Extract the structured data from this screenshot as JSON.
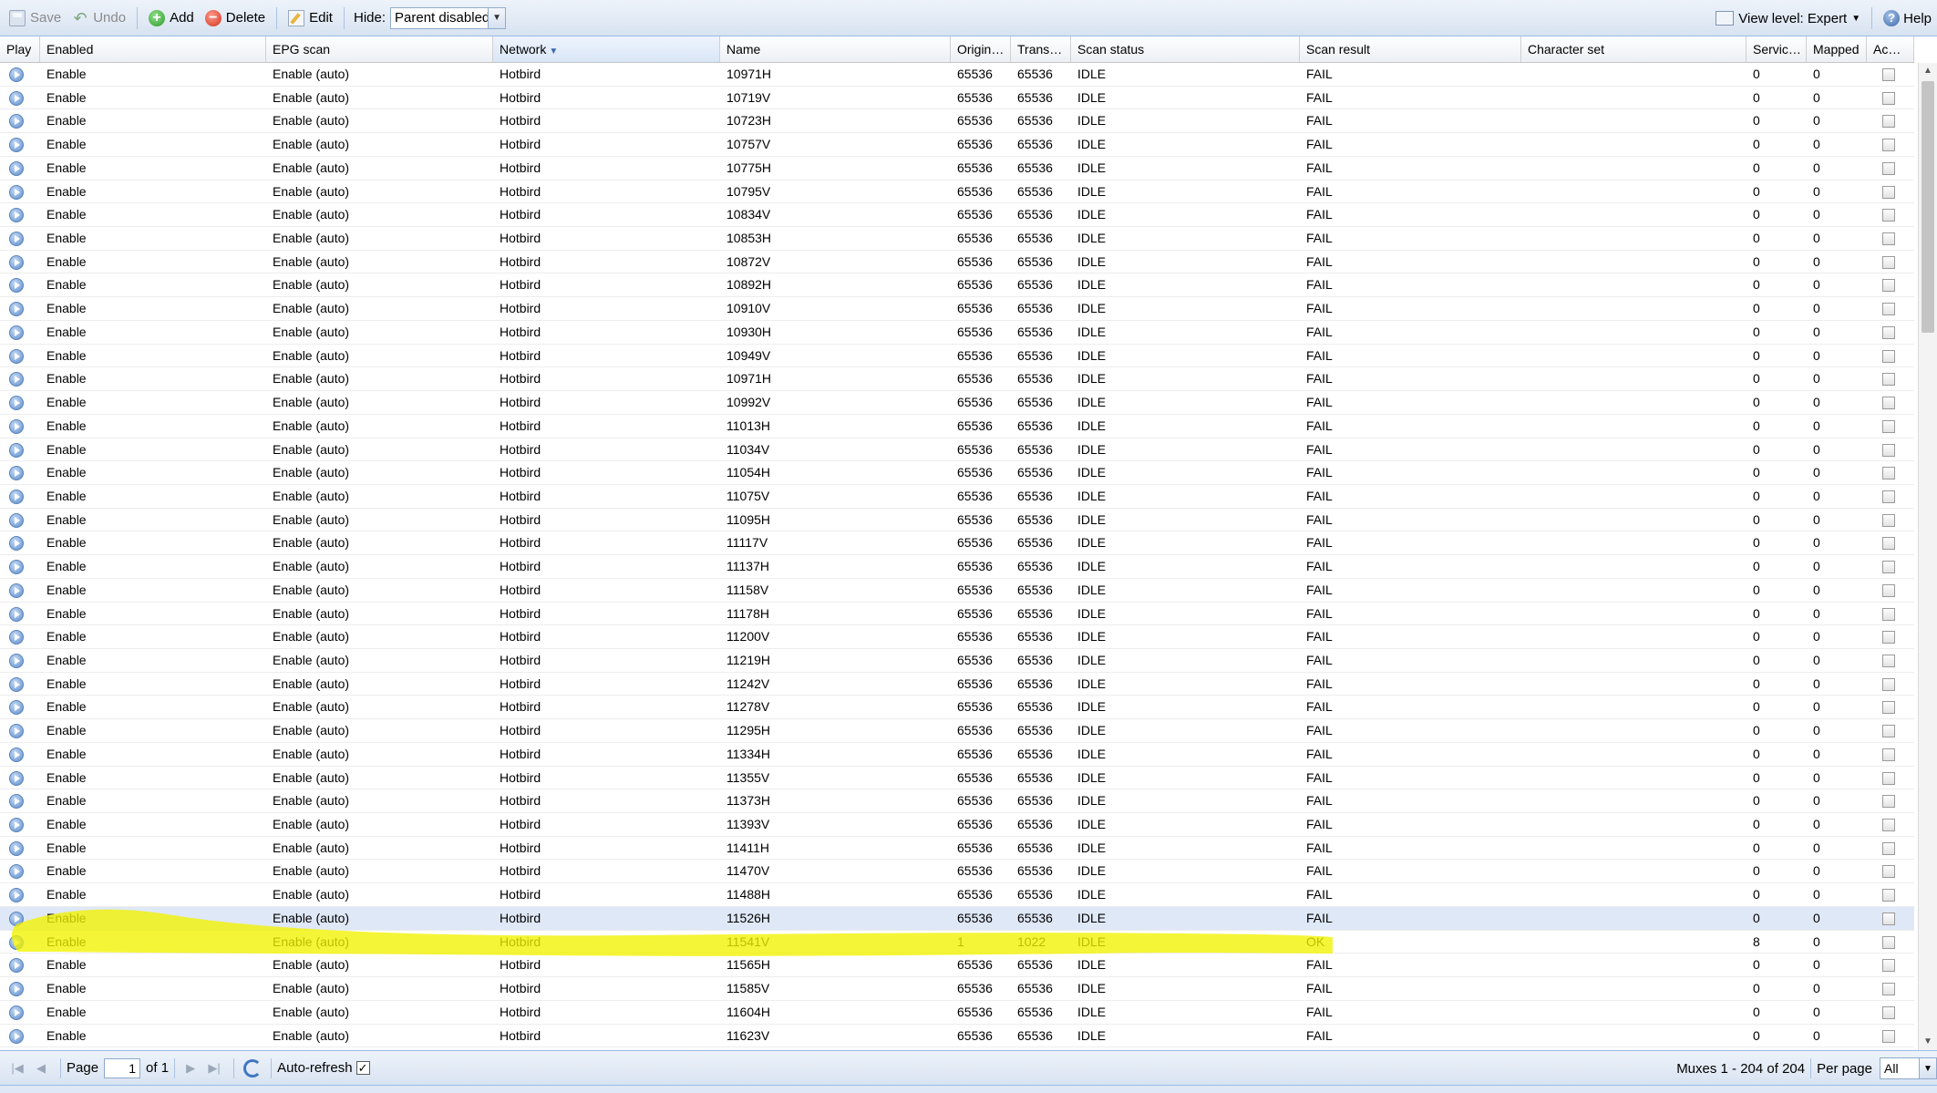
{
  "toolbar": {
    "save_label": "Save",
    "undo_label": "Undo",
    "add_label": "Add",
    "delete_label": "Delete",
    "edit_label": "Edit",
    "hide_label": "Hide:",
    "hide_value": "Parent disabled",
    "view_level": "View level: Expert",
    "help_label": "Help"
  },
  "columns": {
    "play": "Play",
    "enabled": "Enabled",
    "epg": "EPG scan",
    "network": "Network",
    "name": "Name",
    "orig": "Origin…",
    "trans": "Trans…",
    "scan_status": "Scan status",
    "scan_result": "Scan result",
    "charset": "Character set",
    "services": "Servic…",
    "mapped": "Mapped",
    "ac": "Ac…"
  },
  "rows": [
    {
      "enabled": "Enable",
      "epg": "Enable (auto)",
      "network": "Hotbird",
      "name": "10971H",
      "orig": "65536",
      "trans": "65536",
      "status": "IDLE",
      "result": "FAIL",
      "charset": "",
      "services": "0",
      "mapped": "0"
    },
    {
      "enabled": "Enable",
      "epg": "Enable (auto)",
      "network": "Hotbird",
      "name": "10719V",
      "orig": "65536",
      "trans": "65536",
      "status": "IDLE",
      "result": "FAIL",
      "charset": "",
      "services": "0",
      "mapped": "0"
    },
    {
      "enabled": "Enable",
      "epg": "Enable (auto)",
      "network": "Hotbird",
      "name": "10723H",
      "orig": "65536",
      "trans": "65536",
      "status": "IDLE",
      "result": "FAIL",
      "charset": "",
      "services": "0",
      "mapped": "0"
    },
    {
      "enabled": "Enable",
      "epg": "Enable (auto)",
      "network": "Hotbird",
      "name": "10757V",
      "orig": "65536",
      "trans": "65536",
      "status": "IDLE",
      "result": "FAIL",
      "charset": "",
      "services": "0",
      "mapped": "0"
    },
    {
      "enabled": "Enable",
      "epg": "Enable (auto)",
      "network": "Hotbird",
      "name": "10775H",
      "orig": "65536",
      "trans": "65536",
      "status": "IDLE",
      "result": "FAIL",
      "charset": "",
      "services": "0",
      "mapped": "0"
    },
    {
      "enabled": "Enable",
      "epg": "Enable (auto)",
      "network": "Hotbird",
      "name": "10795V",
      "orig": "65536",
      "trans": "65536",
      "status": "IDLE",
      "result": "FAIL",
      "charset": "",
      "services": "0",
      "mapped": "0"
    },
    {
      "enabled": "Enable",
      "epg": "Enable (auto)",
      "network": "Hotbird",
      "name": "10834V",
      "orig": "65536",
      "trans": "65536",
      "status": "IDLE",
      "result": "FAIL",
      "charset": "",
      "services": "0",
      "mapped": "0"
    },
    {
      "enabled": "Enable",
      "epg": "Enable (auto)",
      "network": "Hotbird",
      "name": "10853H",
      "orig": "65536",
      "trans": "65536",
      "status": "IDLE",
      "result": "FAIL",
      "charset": "",
      "services": "0",
      "mapped": "0"
    },
    {
      "enabled": "Enable",
      "epg": "Enable (auto)",
      "network": "Hotbird",
      "name": "10872V",
      "orig": "65536",
      "trans": "65536",
      "status": "IDLE",
      "result": "FAIL",
      "charset": "",
      "services": "0",
      "mapped": "0"
    },
    {
      "enabled": "Enable",
      "epg": "Enable (auto)",
      "network": "Hotbird",
      "name": "10892H",
      "orig": "65536",
      "trans": "65536",
      "status": "IDLE",
      "result": "FAIL",
      "charset": "",
      "services": "0",
      "mapped": "0"
    },
    {
      "enabled": "Enable",
      "epg": "Enable (auto)",
      "network": "Hotbird",
      "name": "10910V",
      "orig": "65536",
      "trans": "65536",
      "status": "IDLE",
      "result": "FAIL",
      "charset": "",
      "services": "0",
      "mapped": "0"
    },
    {
      "enabled": "Enable",
      "epg": "Enable (auto)",
      "network": "Hotbird",
      "name": "10930H",
      "orig": "65536",
      "trans": "65536",
      "status": "IDLE",
      "result": "FAIL",
      "charset": "",
      "services": "0",
      "mapped": "0"
    },
    {
      "enabled": "Enable",
      "epg": "Enable (auto)",
      "network": "Hotbird",
      "name": "10949V",
      "orig": "65536",
      "trans": "65536",
      "status": "IDLE",
      "result": "FAIL",
      "charset": "",
      "services": "0",
      "mapped": "0"
    },
    {
      "enabled": "Enable",
      "epg": "Enable (auto)",
      "network": "Hotbird",
      "name": "10971H",
      "orig": "65536",
      "trans": "65536",
      "status": "IDLE",
      "result": "FAIL",
      "charset": "",
      "services": "0",
      "mapped": "0"
    },
    {
      "enabled": "Enable",
      "epg": "Enable (auto)",
      "network": "Hotbird",
      "name": "10992V",
      "orig": "65536",
      "trans": "65536",
      "status": "IDLE",
      "result": "FAIL",
      "charset": "",
      "services": "0",
      "mapped": "0"
    },
    {
      "enabled": "Enable",
      "epg": "Enable (auto)",
      "network": "Hotbird",
      "name": "11013H",
      "orig": "65536",
      "trans": "65536",
      "status": "IDLE",
      "result": "FAIL",
      "charset": "",
      "services": "0",
      "mapped": "0"
    },
    {
      "enabled": "Enable",
      "epg": "Enable (auto)",
      "network": "Hotbird",
      "name": "11034V",
      "orig": "65536",
      "trans": "65536",
      "status": "IDLE",
      "result": "FAIL",
      "charset": "",
      "services": "0",
      "mapped": "0"
    },
    {
      "enabled": "Enable",
      "epg": "Enable (auto)",
      "network": "Hotbird",
      "name": "11054H",
      "orig": "65536",
      "trans": "65536",
      "status": "IDLE",
      "result": "FAIL",
      "charset": "",
      "services": "0",
      "mapped": "0"
    },
    {
      "enabled": "Enable",
      "epg": "Enable (auto)",
      "network": "Hotbird",
      "name": "11075V",
      "orig": "65536",
      "trans": "65536",
      "status": "IDLE",
      "result": "FAIL",
      "charset": "",
      "services": "0",
      "mapped": "0"
    },
    {
      "enabled": "Enable",
      "epg": "Enable (auto)",
      "network": "Hotbird",
      "name": "11095H",
      "orig": "65536",
      "trans": "65536",
      "status": "IDLE",
      "result": "FAIL",
      "charset": "",
      "services": "0",
      "mapped": "0"
    },
    {
      "enabled": "Enable",
      "epg": "Enable (auto)",
      "network": "Hotbird",
      "name": "11117V",
      "orig": "65536",
      "trans": "65536",
      "status": "IDLE",
      "result": "FAIL",
      "charset": "",
      "services": "0",
      "mapped": "0"
    },
    {
      "enabled": "Enable",
      "epg": "Enable (auto)",
      "network": "Hotbird",
      "name": "11137H",
      "orig": "65536",
      "trans": "65536",
      "status": "IDLE",
      "result": "FAIL",
      "charset": "",
      "services": "0",
      "mapped": "0"
    },
    {
      "enabled": "Enable",
      "epg": "Enable (auto)",
      "network": "Hotbird",
      "name": "11158V",
      "orig": "65536",
      "trans": "65536",
      "status": "IDLE",
      "result": "FAIL",
      "charset": "",
      "services": "0",
      "mapped": "0"
    },
    {
      "enabled": "Enable",
      "epg": "Enable (auto)",
      "network": "Hotbird",
      "name": "11178H",
      "orig": "65536",
      "trans": "65536",
      "status": "IDLE",
      "result": "FAIL",
      "charset": "",
      "services": "0",
      "mapped": "0"
    },
    {
      "enabled": "Enable",
      "epg": "Enable (auto)",
      "network": "Hotbird",
      "name": "11200V",
      "orig": "65536",
      "trans": "65536",
      "status": "IDLE",
      "result": "FAIL",
      "charset": "",
      "services": "0",
      "mapped": "0"
    },
    {
      "enabled": "Enable",
      "epg": "Enable (auto)",
      "network": "Hotbird",
      "name": "11219H",
      "orig": "65536",
      "trans": "65536",
      "status": "IDLE",
      "result": "FAIL",
      "charset": "",
      "services": "0",
      "mapped": "0"
    },
    {
      "enabled": "Enable",
      "epg": "Enable (auto)",
      "network": "Hotbird",
      "name": "11242V",
      "orig": "65536",
      "trans": "65536",
      "status": "IDLE",
      "result": "FAIL",
      "charset": "",
      "services": "0",
      "mapped": "0"
    },
    {
      "enabled": "Enable",
      "epg": "Enable (auto)",
      "network": "Hotbird",
      "name": "11278V",
      "orig": "65536",
      "trans": "65536",
      "status": "IDLE",
      "result": "FAIL",
      "charset": "",
      "services": "0",
      "mapped": "0"
    },
    {
      "enabled": "Enable",
      "epg": "Enable (auto)",
      "network": "Hotbird",
      "name": "11295H",
      "orig": "65536",
      "trans": "65536",
      "status": "IDLE",
      "result": "FAIL",
      "charset": "",
      "services": "0",
      "mapped": "0"
    },
    {
      "enabled": "Enable",
      "epg": "Enable (auto)",
      "network": "Hotbird",
      "name": "11334H",
      "orig": "65536",
      "trans": "65536",
      "status": "IDLE",
      "result": "FAIL",
      "charset": "",
      "services": "0",
      "mapped": "0"
    },
    {
      "enabled": "Enable",
      "epg": "Enable (auto)",
      "network": "Hotbird",
      "name": "11355V",
      "orig": "65536",
      "trans": "65536",
      "status": "IDLE",
      "result": "FAIL",
      "charset": "",
      "services": "0",
      "mapped": "0"
    },
    {
      "enabled": "Enable",
      "epg": "Enable (auto)",
      "network": "Hotbird",
      "name": "11373H",
      "orig": "65536",
      "trans": "65536",
      "status": "IDLE",
      "result": "FAIL",
      "charset": "",
      "services": "0",
      "mapped": "0"
    },
    {
      "enabled": "Enable",
      "epg": "Enable (auto)",
      "network": "Hotbird",
      "name": "11393V",
      "orig": "65536",
      "trans": "65536",
      "status": "IDLE",
      "result": "FAIL",
      "charset": "",
      "services": "0",
      "mapped": "0"
    },
    {
      "enabled": "Enable",
      "epg": "Enable (auto)",
      "network": "Hotbird",
      "name": "11411H",
      "orig": "65536",
      "trans": "65536",
      "status": "IDLE",
      "result": "FAIL",
      "charset": "",
      "services": "0",
      "mapped": "0"
    },
    {
      "enabled": "Enable",
      "epg": "Enable (auto)",
      "network": "Hotbird",
      "name": "11470V",
      "orig": "65536",
      "trans": "65536",
      "status": "IDLE",
      "result": "FAIL",
      "charset": "",
      "services": "0",
      "mapped": "0"
    },
    {
      "enabled": "Enable",
      "epg": "Enable (auto)",
      "network": "Hotbird",
      "name": "11488H",
      "orig": "65536",
      "trans": "65536",
      "status": "IDLE",
      "result": "FAIL",
      "charset": "",
      "services": "0",
      "mapped": "0"
    },
    {
      "enabled": "Enable",
      "epg": "Enable (auto)",
      "network": "Hotbird",
      "name": "11526H",
      "orig": "65536",
      "trans": "65536",
      "status": "IDLE",
      "result": "FAIL",
      "charset": "",
      "services": "0",
      "mapped": "0",
      "selected": true
    },
    {
      "enabled": "Enable",
      "epg": "Enable (auto)",
      "network": "Hotbird",
      "name": "11541V",
      "orig": "1",
      "trans": "1022",
      "status": "IDLE",
      "result": "OK",
      "charset": "",
      "services": "8",
      "mapped": "0"
    },
    {
      "enabled": "Enable",
      "epg": "Enable (auto)",
      "network": "Hotbird",
      "name": "11565H",
      "orig": "65536",
      "trans": "65536",
      "status": "IDLE",
      "result": "FAIL",
      "charset": "",
      "services": "0",
      "mapped": "0"
    },
    {
      "enabled": "Enable",
      "epg": "Enable (auto)",
      "network": "Hotbird",
      "name": "11585V",
      "orig": "65536",
      "trans": "65536",
      "status": "IDLE",
      "result": "FAIL",
      "charset": "",
      "services": "0",
      "mapped": "0"
    },
    {
      "enabled": "Enable",
      "epg": "Enable (auto)",
      "network": "Hotbird",
      "name": "11604H",
      "orig": "65536",
      "trans": "65536",
      "status": "IDLE",
      "result": "FAIL",
      "charset": "",
      "services": "0",
      "mapped": "0"
    },
    {
      "enabled": "Enable",
      "epg": "Enable (auto)",
      "network": "Hotbird",
      "name": "11623V",
      "orig": "65536",
      "trans": "65536",
      "status": "IDLE",
      "result": "FAIL",
      "charset": "",
      "services": "0",
      "mapped": "0"
    }
  ],
  "pager": {
    "page_label": "Page",
    "page_value": "1",
    "of_label": "of 1",
    "auto_refresh_label": "Auto-refresh",
    "auto_refresh_mark": "✓",
    "display_info": "Muxes 1 - 204 of 204",
    "per_page_label": "Per page",
    "per_page_value": "All"
  },
  "colors": {
    "highlight": "#f2f200",
    "header_bg": "#dfe8f6",
    "selected_row": "#dfe8f6"
  },
  "icons": {
    "play": "play-icon",
    "save": "save-icon",
    "undo": "undo-icon",
    "add": "add-icon",
    "delete": "delete-icon",
    "edit": "edit-icon",
    "help": "help-icon",
    "refresh": "refresh-icon"
  }
}
